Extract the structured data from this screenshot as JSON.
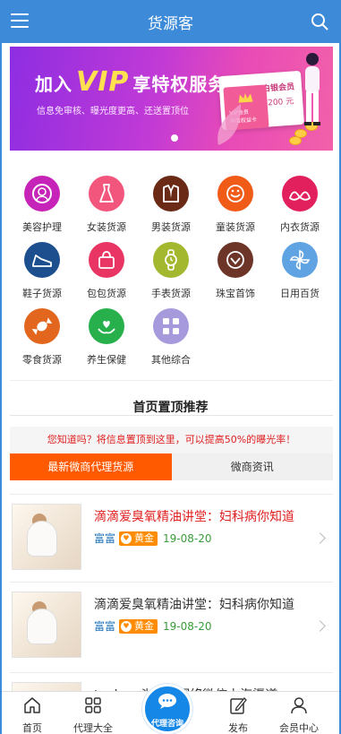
{
  "header": {
    "title": "货源客"
  },
  "banner": {
    "headline_pre": "加入",
    "headline_vip": "VIP",
    "headline_post": "享特权服务",
    "subline": "信息免审核、曝光度更高、还送置顶位",
    "card_title": "白银会员",
    "card_price": "仅需 200 元",
    "card_small_1": "VIP会员",
    "card_small_2": "年度权益卡"
  },
  "categories": [
    {
      "label": "美容护理",
      "icon": "beauty-icon",
      "color": "#c623b8"
    },
    {
      "label": "女装货源",
      "icon": "dress-icon",
      "color": "#f2567d"
    },
    {
      "label": "男装货源",
      "icon": "suit-icon",
      "color": "#6b2a15"
    },
    {
      "label": "童装货源",
      "icon": "kids-clothing-icon",
      "color": "#f05b18"
    },
    {
      "label": "内衣货源",
      "icon": "underwear-icon",
      "color": "#e3205e"
    },
    {
      "label": "鞋子货源",
      "icon": "shoe-icon",
      "color": "#1d4f8e"
    },
    {
      "label": "包包货源",
      "icon": "bag-icon",
      "color": "#e83563"
    },
    {
      "label": "手表货源",
      "icon": "watch-icon",
      "color": "#a4b82f"
    },
    {
      "label": "珠宝首饰",
      "icon": "jewelry-icon",
      "color": "#6d3527"
    },
    {
      "label": "日用百货",
      "icon": "pinwheel-icon",
      "color": "#5fa3e2"
    },
    {
      "label": "零食货源",
      "icon": "candy-icon",
      "color": "#e2661e"
    },
    {
      "label": "养生保健",
      "icon": "health-heart-icon",
      "color": "#27b04b"
    },
    {
      "label": "其他综合",
      "icon": "grid-icon",
      "color": "#a69adc"
    }
  ],
  "section": {
    "title": "首页置顶推荐",
    "notice": "您知道吗？将信息置顶到这里，可以提高50%的曝光率！"
  },
  "tabs": [
    {
      "label": "最新微商代理货源",
      "active": true
    },
    {
      "label": "微商资讯",
      "active": false
    }
  ],
  "items": [
    {
      "title": "滴滴爱臭氧精油讲堂：妇科病你知道",
      "title_color": "#e0201f",
      "user": "富富",
      "badge": "黄金",
      "date": "19-08-20"
    },
    {
      "title": "滴滴爱臭氧精油讲堂：妇科病你知道",
      "title_color": "#333333",
      "user": "富富",
      "badge": "黄金",
      "date": "19-08-20"
    },
    {
      "title": "toolous头头乐网络微信上海渠道",
      "title_color": "#333333",
      "user": "",
      "badge": "",
      "date": ""
    }
  ],
  "tabbar": {
    "home": "首页",
    "agents": "代理大全",
    "consult": "代理咨询",
    "publish": "发布",
    "member": "会员中心"
  }
}
